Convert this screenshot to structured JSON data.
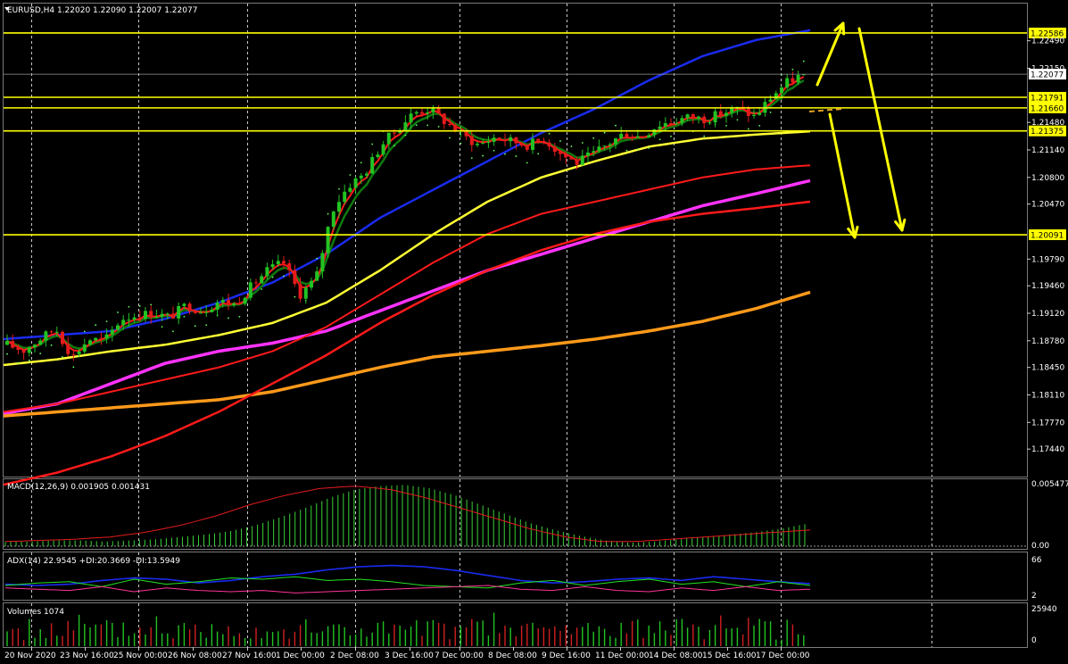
{
  "colors": {
    "background": "#000000",
    "grid": "#c8c8c8",
    "bull": "#22c322",
    "bear": "#e31b1b",
    "level": "#ffff00",
    "ma_blue": "#1a2bf0",
    "ma_yellow": "#ffff33",
    "ma_magenta": "#ff33ff",
    "ma_red": "#ff1a1a",
    "ma_orange": "#ff9a1a",
    "ema_fast": "#ff1a1a",
    "ema_slow": "#0f7a0f",
    "psar": "#66ff66",
    "macd_hist": "#39d239",
    "macd_signal": "#e31b1b",
    "adx_main": "#1a2bf0",
    "adx_plus": "#22e322",
    "adx_minus": "#ff3399",
    "volume": "#22c322",
    "price_tag_bg": "#ffff00",
    "current_tag_bg": "#ffffff"
  },
  "header": {
    "symbol_line": "EURUSD,H4  1.22020 1.22090 1.22007 1.22077"
  },
  "chart_data": [
    {
      "type": "candlestick",
      "title": "EURUSD,H4",
      "ohlc_last": {
        "open": 1.2202,
        "high": 1.2209,
        "low": 1.22007,
        "close": 1.22077
      },
      "ylim": [
        1.171,
        1.2295
      ],
      "y_ticks": [
        "1.22490",
        "1.22150",
        "1.21480",
        "1.21140",
        "1.20800",
        "1.20470",
        "1.19790",
        "1.19460",
        "1.19120",
        "1.18780",
        "1.18450",
        "1.18110",
        "1.17770",
        "1.17440"
      ],
      "x_ticks": [
        "20 Nov 2020",
        "23 Nov 16:00",
        "25 Nov 00:00",
        "26 Nov 08:00",
        "27 Nov 16:00",
        "1 Dec 00:00",
        "2 Dec 08:00",
        "3 Dec 16:00",
        "7 Dec 00:00",
        "8 Dec 08:00",
        "9 Dec 16:00",
        "11 Dec 00:00",
        "14 Dec 08:00",
        "15 Dec 16:00",
        "17 Dec 00:00"
      ],
      "levels": [
        {
          "value": 1.22586,
          "label": "1.22586"
        },
        {
          "value": 1.21791,
          "label": "1.21791"
        },
        {
          "value": 1.2166,
          "label": "1.21660"
        },
        {
          "value": 1.21375,
          "label": "1.21375"
        },
        {
          "value": 1.20091,
          "label": "1.20091"
        }
      ],
      "current_price": {
        "value": 1.22077,
        "label": "1.22077"
      },
      "close_path": [
        1.1873,
        1.1866,
        1.188,
        1.1893,
        1.1858,
        1.188,
        1.1878,
        1.1905,
        1.191,
        1.1912,
        1.1907,
        1.1922,
        1.1915,
        1.1927,
        1.1923,
        1.1945,
        1.1965,
        1.1975,
        1.1935,
        1.1955,
        1.204,
        1.207,
        1.2085,
        1.212,
        1.214,
        1.216,
        1.2165,
        1.2148,
        1.2132,
        1.212,
        1.213,
        1.2125,
        1.212,
        1.2128,
        1.211,
        1.2098,
        1.2108,
        1.2122,
        1.2135,
        1.213,
        1.2145,
        1.215,
        1.2155,
        1.2152,
        1.216,
        1.2165,
        1.2155,
        1.218,
        1.2198,
        1.2208
      ],
      "moving_averages": [
        {
          "name": "",
          "color": "ma_blue",
          "values": [
            1.188,
            1.1885,
            1.189,
            1.1905,
            1.1925,
            1.195,
            1.1985,
            1.203,
            1.2065,
            1.21,
            1.2135,
            1.2165,
            1.22,
            1.223,
            1.225,
            1.2262
          ]
        },
        {
          "name": "",
          "color": "ma_yellow",
          "values": [
            1.1848,
            1.1855,
            1.1865,
            1.1873,
            1.1885,
            1.19,
            1.1925,
            1.1965,
            1.201,
            1.205,
            1.208,
            1.21,
            1.2118,
            1.2128,
            1.2133,
            1.2137
          ]
        },
        {
          "name": "",
          "color": "ma_magenta",
          "values": [
            1.1788,
            1.18,
            1.1825,
            1.185,
            1.1865,
            1.1875,
            1.189,
            1.1915,
            1.194,
            1.1965,
            1.1985,
            1.2005,
            1.2025,
            1.2045,
            1.206,
            1.2076
          ]
        },
        {
          "name": "",
          "color": "ma_red",
          "values": [
            1.179,
            1.18,
            1.1815,
            1.183,
            1.1845,
            1.1865,
            1.1895,
            1.1935,
            1.1975,
            1.201,
            1.2035,
            1.205,
            1.2065,
            1.208,
            1.209,
            1.2095
          ]
        },
        {
          "name": "",
          "color": "ma_orange",
          "values": [
            1.1785,
            1.179,
            1.1795,
            1.18,
            1.1805,
            1.1815,
            1.183,
            1.1845,
            1.1858,
            1.1865,
            1.1872,
            1.188,
            1.189,
            1.1902,
            1.1918,
            1.1938
          ]
        },
        {
          "name": "",
          "color": "ma_red",
          "values": [
            1.17,
            1.1715,
            1.1735,
            1.176,
            1.179,
            1.1825,
            1.186,
            1.19,
            1.1935,
            1.1965,
            1.199,
            1.201,
            1.2025,
            1.2035,
            1.2042,
            1.205
          ]
        }
      ]
    },
    {
      "type": "bar",
      "title": "MACD(12,26,9) 0.001905 0.001431",
      "ylim": [
        0,
        0.005477
      ],
      "y_ticks": [
        "0.005477",
        "0.00"
      ],
      "histogram": [
        0.0004,
        0.0004,
        0.0005,
        0.0005,
        0.0004,
        0.0005,
        0.0006,
        0.0008,
        0.001,
        0.0013,
        0.0018,
        0.0025,
        0.0033,
        0.0042,
        0.0049,
        0.0052,
        0.0053,
        0.005,
        0.0044,
        0.0036,
        0.0028,
        0.002,
        0.0014,
        0.0009,
        0.0005,
        0.0003,
        0.0004,
        0.0006,
        0.0008,
        0.001,
        0.0012,
        0.0015,
        0.0019
      ],
      "signal": [
        0.0004,
        0.0005,
        0.0006,
        0.0008,
        0.0012,
        0.0018,
        0.0026,
        0.0036,
        0.0044,
        0.005,
        0.0052,
        0.0049,
        0.0042,
        0.0033,
        0.0024,
        0.0015,
        0.0008,
        0.0004,
        0.0004,
        0.0006,
        0.0008,
        0.001,
        0.0012,
        0.0014
      ]
    },
    {
      "type": "line",
      "title": "ADX(14) 22.9545 +DI:20.3669 -DI:13.5949",
      "ylim": [
        0,
        70
      ],
      "y_ticks": [
        "66",
        "2"
      ],
      "series": [
        {
          "name": "",
          "color": "adx_main",
          "values": [
            22,
            20,
            22,
            28,
            32,
            30,
            24,
            28,
            34,
            38,
            45,
            50,
            52,
            50,
            44,
            36,
            28,
            24,
            26,
            30,
            32,
            28,
            34,
            30,
            26,
            23
          ]
        },
        {
          "name": "",
          "color": "adx_plus",
          "values": [
            20,
            24,
            26,
            18,
            30,
            22,
            26,
            32,
            30,
            34,
            28,
            30,
            26,
            20,
            18,
            16,
            24,
            28,
            20,
            26,
            30,
            22,
            26,
            18,
            26,
            20
          ]
        },
        {
          "name": "",
          "color": "adx_minus",
          "values": [
            16,
            14,
            12,
            18,
            10,
            16,
            12,
            10,
            12,
            8,
            10,
            12,
            14,
            16,
            18,
            20,
            14,
            12,
            18,
            12,
            10,
            16,
            12,
            18,
            12,
            14
          ]
        }
      ]
    },
    {
      "type": "bar",
      "title": "Volumes 1074",
      "ylim": [
        0,
        25940
      ],
      "y_ticks": [
        "25940",
        "0"
      ]
    }
  ]
}
